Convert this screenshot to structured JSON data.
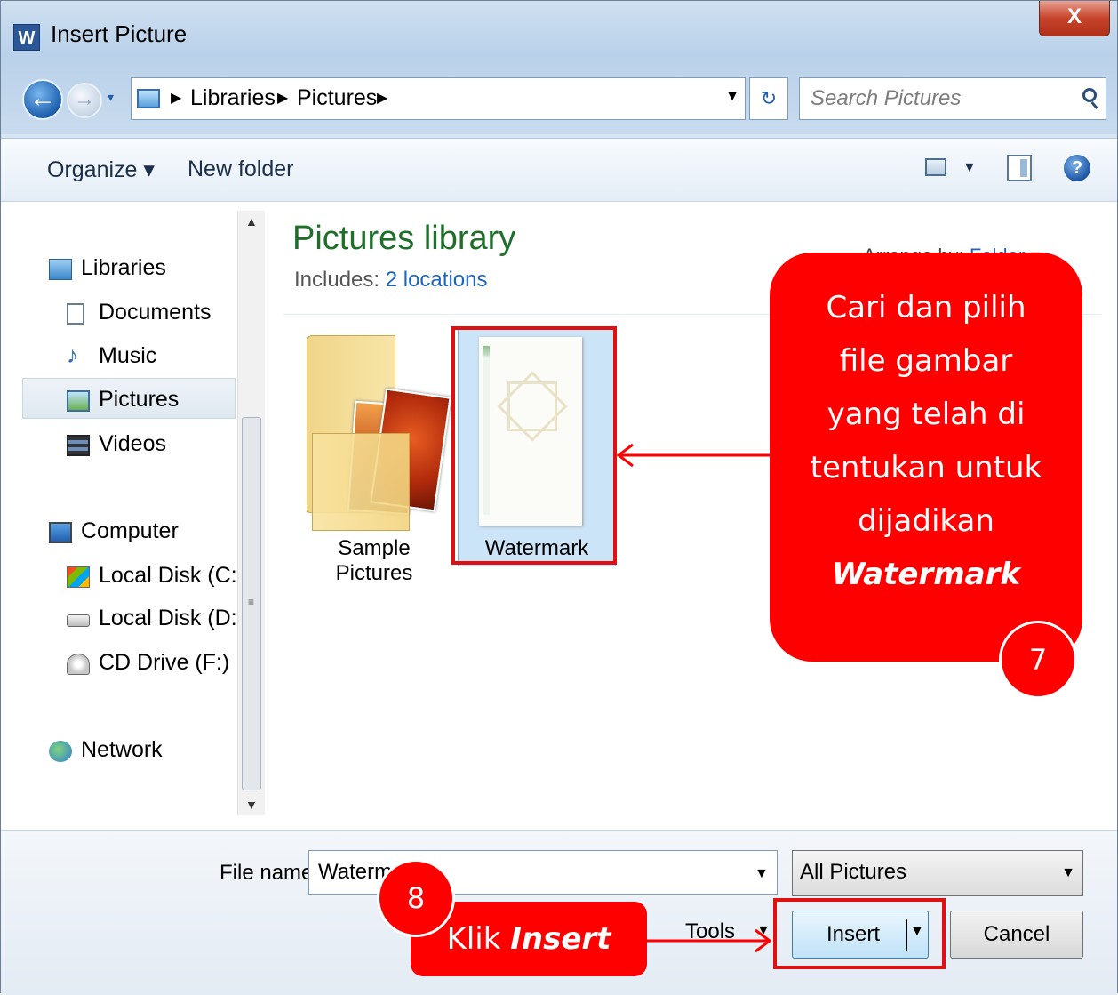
{
  "window": {
    "app_icon": "W",
    "title": "Insert Picture",
    "close_label": "X"
  },
  "nav": {
    "breadcrumbs": [
      "Libraries",
      "Pictures"
    ],
    "search_placeholder": "Search Pictures"
  },
  "toolbar": {
    "organize": "Organize ▾",
    "new_folder": "New folder"
  },
  "sidebar": {
    "items": [
      {
        "label": "Libraries",
        "icon": "libraries-icon"
      },
      {
        "label": "Documents",
        "icon": "documents-icon"
      },
      {
        "label": "Music",
        "icon": "music-icon"
      },
      {
        "label": "Pictures",
        "icon": "pictures-icon",
        "selected": true
      },
      {
        "label": "Videos",
        "icon": "videos-icon"
      },
      {
        "label": "Computer",
        "icon": "computer-icon"
      },
      {
        "label": "Local Disk (C:)",
        "icon": "local-disk-c-icon"
      },
      {
        "label": "Local Disk (D:)",
        "icon": "local-disk-d-icon"
      },
      {
        "label": "CD Drive (F:)",
        "icon": "cd-drive-icon"
      },
      {
        "label": "Network",
        "icon": "network-icon"
      }
    ]
  },
  "content": {
    "title": "Pictures library",
    "includes_label": "Includes:",
    "includes_value": "2 locations",
    "arrange_label": "Arrange by:",
    "arrange_value": "Folder ▾",
    "files": [
      {
        "name": "Sample Pictures",
        "type": "folder"
      },
      {
        "name": "Watermark",
        "type": "image",
        "selected": true
      }
    ]
  },
  "footer": {
    "file_name_label": "File name:",
    "file_name_value": "Watermark",
    "filter_value": "All Pictures",
    "tools_label": "Tools",
    "insert_label": "Insert",
    "cancel_label": "Cancel"
  },
  "annotations": {
    "step7": {
      "number": "7",
      "lines": [
        "Cari dan pilih",
        "file gambar",
        "yang telah di",
        "tentukan untuk",
        "dijadikan"
      ],
      "emphasis": "Watermark"
    },
    "step8": {
      "number": "8",
      "prefix": "Klik ",
      "emphasis": "Insert"
    },
    "color": "#ff0000"
  }
}
